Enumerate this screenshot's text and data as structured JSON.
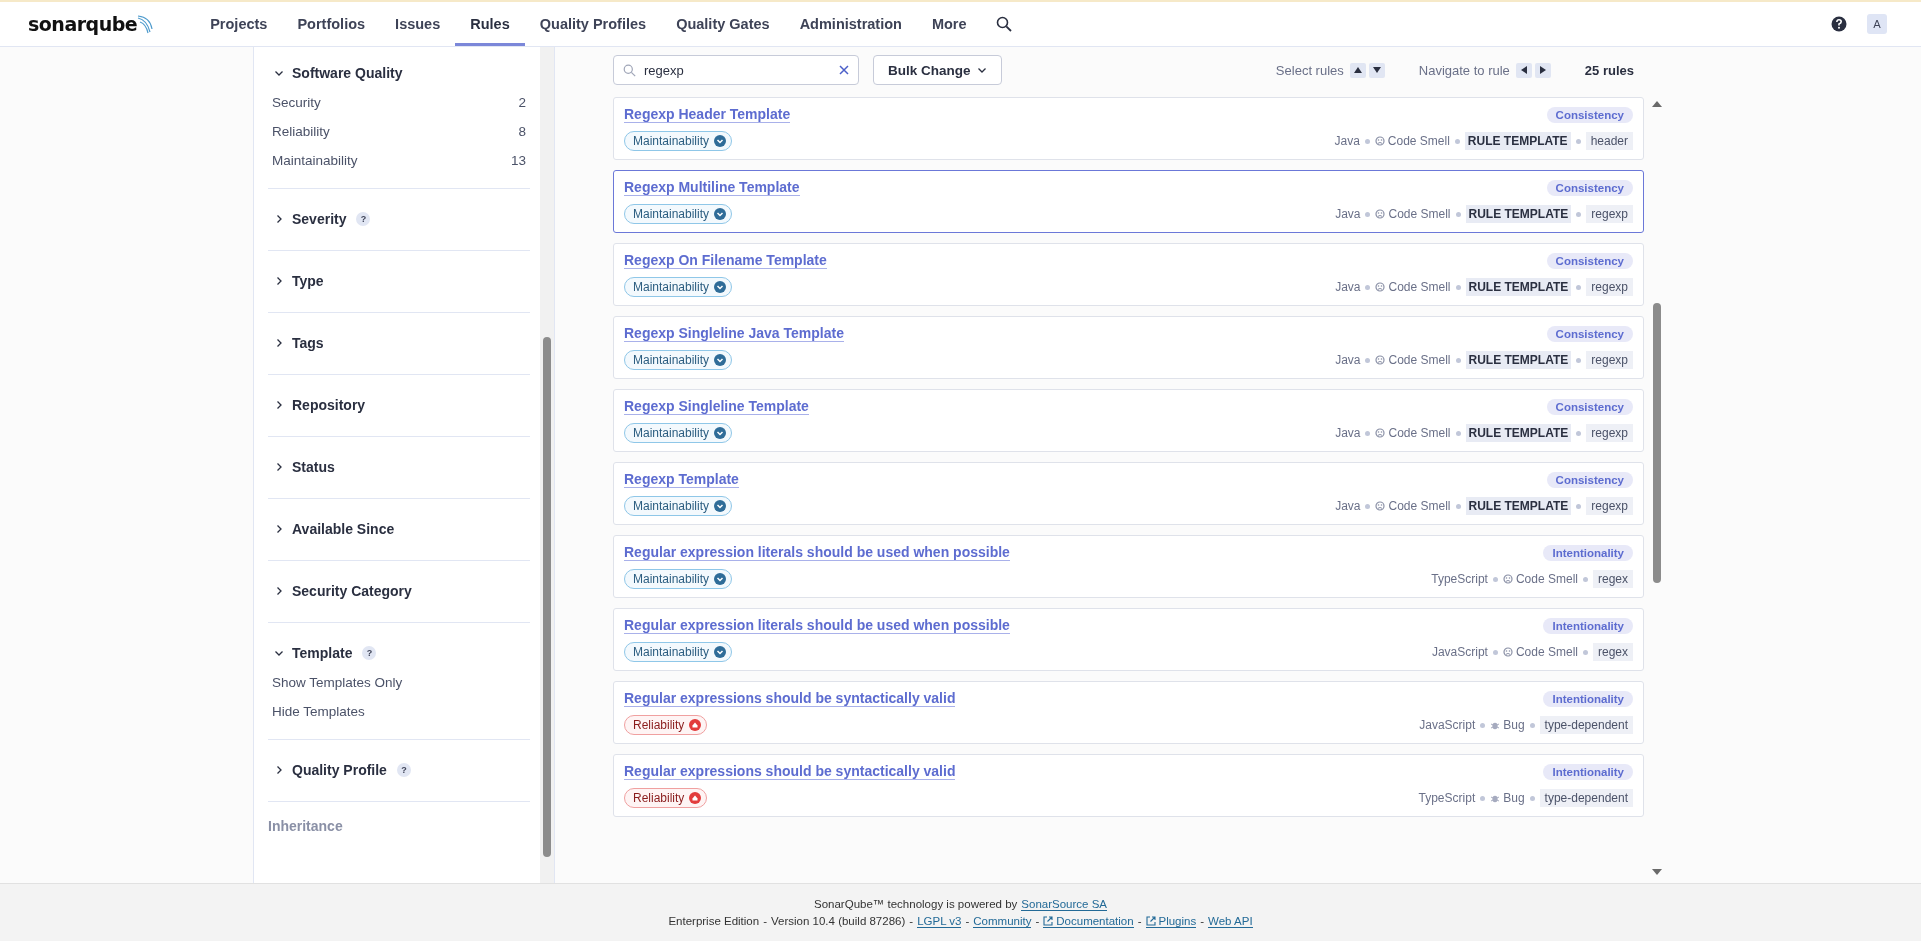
{
  "header": {
    "logo": "sonarqube",
    "nav": [
      {
        "label": "Projects",
        "selected": false
      },
      {
        "label": "Portfolios",
        "selected": false
      },
      {
        "label": "Issues",
        "selected": false
      },
      {
        "label": "Rules",
        "selected": true
      },
      {
        "label": "Quality Profiles",
        "selected": false
      },
      {
        "label": "Quality Gates",
        "selected": false
      },
      {
        "label": "Administration",
        "selected": false
      },
      {
        "label": "More",
        "selected": false
      }
    ],
    "avatar": "A"
  },
  "sidebar": {
    "facets": [
      {
        "title": "Software Quality",
        "expanded": true,
        "items": [
          {
            "label": "Security",
            "count": "2"
          },
          {
            "label": "Reliability",
            "count": "8"
          },
          {
            "label": "Maintainability",
            "count": "13"
          }
        ]
      },
      {
        "title": "Severity",
        "expanded": false,
        "help": "?"
      },
      {
        "title": "Type",
        "expanded": false
      },
      {
        "title": "Tags",
        "expanded": false
      },
      {
        "title": "Repository",
        "expanded": false
      },
      {
        "title": "Status",
        "expanded": false
      },
      {
        "title": "Available Since",
        "expanded": false
      },
      {
        "title": "Security Category",
        "expanded": false
      },
      {
        "title": "Template",
        "expanded": true,
        "help": "?",
        "items": [
          {
            "label": "Show Templates Only"
          },
          {
            "label": "Hide Templates"
          }
        ]
      },
      {
        "title": "Quality Profile",
        "expanded": false,
        "help": "?"
      }
    ],
    "inheritance": {
      "label": "Inheritance",
      "disabled": true
    }
  },
  "toolbar": {
    "search": {
      "value": "regexp"
    },
    "bulk_change": "Bulk Change",
    "select_rules": "Select rules",
    "navigate": "Navigate to rule",
    "count": "25 rules"
  },
  "rules": [
    {
      "title": "Regexp Header Template",
      "attribute": "Consistency",
      "quality": {
        "label": "Maintainability",
        "kind": "maintainability"
      },
      "language": "Java",
      "type": {
        "label": "Code Smell",
        "kind": "code_smell"
      },
      "template": "RULE TEMPLATE",
      "tag": "header",
      "selected": false
    },
    {
      "title": "Regexp Multiline Template",
      "attribute": "Consistency",
      "quality": {
        "label": "Maintainability",
        "kind": "maintainability"
      },
      "language": "Java",
      "type": {
        "label": "Code Smell",
        "kind": "code_smell"
      },
      "template": "RULE TEMPLATE",
      "tag": "regexp",
      "selected": true
    },
    {
      "title": "Regexp On Filename Template",
      "attribute": "Consistency",
      "quality": {
        "label": "Maintainability",
        "kind": "maintainability"
      },
      "language": "Java",
      "type": {
        "label": "Code Smell",
        "kind": "code_smell"
      },
      "template": "RULE TEMPLATE",
      "tag": "regexp",
      "selected": false
    },
    {
      "title": "Regexp Singleline Java Template",
      "attribute": "Consistency",
      "quality": {
        "label": "Maintainability",
        "kind": "maintainability"
      },
      "language": "Java",
      "type": {
        "label": "Code Smell",
        "kind": "code_smell"
      },
      "template": "RULE TEMPLATE",
      "tag": "regexp",
      "selected": false
    },
    {
      "title": "Regexp Singleline Template",
      "attribute": "Consistency",
      "quality": {
        "label": "Maintainability",
        "kind": "maintainability"
      },
      "language": "Java",
      "type": {
        "label": "Code Smell",
        "kind": "code_smell"
      },
      "template": "RULE TEMPLATE",
      "tag": "regexp",
      "selected": false
    },
    {
      "title": "Regexp Template",
      "attribute": "Consistency",
      "quality": {
        "label": "Maintainability",
        "kind": "maintainability"
      },
      "language": "Java",
      "type": {
        "label": "Code Smell",
        "kind": "code_smell"
      },
      "template": "RULE TEMPLATE",
      "tag": "regexp",
      "selected": false
    },
    {
      "title": "Regular expression literals should be used when possible",
      "attribute": "Intentionality",
      "quality": {
        "label": "Maintainability",
        "kind": "maintainability"
      },
      "language": "TypeScript",
      "type": {
        "label": "Code Smell",
        "kind": "code_smell"
      },
      "tag": "regex",
      "selected": false
    },
    {
      "title": "Regular expression literals should be used when possible",
      "attribute": "Intentionality",
      "quality": {
        "label": "Maintainability",
        "kind": "maintainability"
      },
      "language": "JavaScript",
      "type": {
        "label": "Code Smell",
        "kind": "code_smell"
      },
      "tag": "regex",
      "selected": false
    },
    {
      "title": "Regular expressions should be syntactically valid",
      "attribute": "Intentionality",
      "quality": {
        "label": "Reliability",
        "kind": "reliability"
      },
      "language": "JavaScript",
      "type": {
        "label": "Bug",
        "kind": "bug"
      },
      "tag": "type-dependent",
      "selected": false
    },
    {
      "title": "Regular expressions should be syntactically valid",
      "attribute": "Intentionality",
      "quality": {
        "label": "Reliability",
        "kind": "reliability"
      },
      "language": "TypeScript",
      "type": {
        "label": "Bug",
        "kind": "bug"
      },
      "tag": "type-dependent",
      "selected": false
    }
  ],
  "footer": {
    "line1": [
      {
        "kind": "text",
        "text": "SonarQube™ technology is powered by"
      },
      {
        "kind": "link",
        "text": "SonarSource SA"
      }
    ],
    "line2": [
      {
        "kind": "text",
        "text": "Enterprise Edition"
      },
      {
        "kind": "text",
        "text": "-"
      },
      {
        "kind": "text",
        "text": "Version 10.4 (build 87286)"
      },
      {
        "kind": "text",
        "text": "-"
      },
      {
        "kind": "link",
        "text": "LGPL v3"
      },
      {
        "kind": "text",
        "text": "-"
      },
      {
        "kind": "link",
        "text": "Community"
      },
      {
        "kind": "text",
        "text": "-"
      },
      {
        "kind": "external_link",
        "text": "Documentation"
      },
      {
        "kind": "text",
        "text": "-"
      },
      {
        "kind": "external_link",
        "text": "Plugins"
      },
      {
        "kind": "text",
        "text": "-"
      },
      {
        "kind": "link",
        "text": "Web API"
      }
    ]
  }
}
